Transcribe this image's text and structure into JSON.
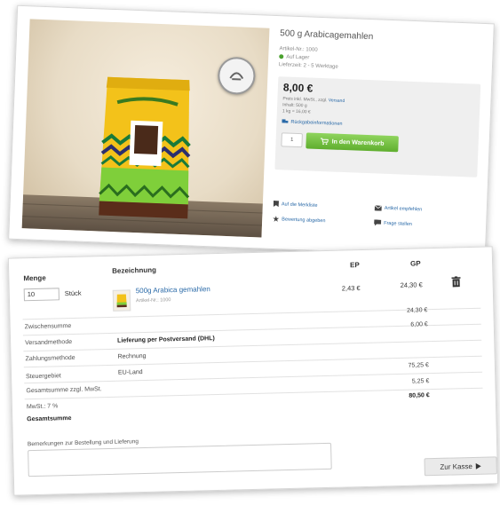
{
  "product": {
    "title": "500 g Arabicagemahlen",
    "article_no": "Artikel-Nr.: 1000",
    "availability": "Auf Lager",
    "delivery": "Lieferzeit: 2 - 5 Werktage",
    "price": "8,00 €",
    "price_note": "Preis inkl. MwSt., zzgl.",
    "shipping_link": "Versand",
    "unit_price": "Inhalt: 500 g",
    "base_price": "1 kg = 16,00 €",
    "basket_link": "Rückgabeinformationen",
    "qty_value": "1",
    "cart_button": "In den Warenkorb",
    "actions": [
      {
        "label": "Auf die Merkliste",
        "icon": "bookmark-icon"
      },
      {
        "label": "Artikel empfehlen",
        "icon": "mail-icon"
      },
      {
        "label": "Bewertung abgeben",
        "icon": "star-icon"
      },
      {
        "label": "Frage stellen",
        "icon": "chat-icon"
      }
    ]
  },
  "cart": {
    "headers": {
      "qty": "Menge",
      "desc": "Bezeichnung",
      "unit": "EP",
      "total": "GP"
    },
    "item": {
      "qty": "10",
      "unit_label": "Stück",
      "name": "500g Arabica gemahlen",
      "article_no": "Artikel-Nr.: 1000",
      "unit_price": "2,43 €",
      "total_price": "24,30 €"
    },
    "summary": [
      {
        "label": "Zwischensumme",
        "value": "",
        "amount": "24,30 €",
        "bold": false
      },
      {
        "label": "Versandmethode",
        "value": "Lieferung per Postversand (DHL)",
        "amount": "6,00 €",
        "bold": true
      },
      {
        "label": "Zahlungsmethode",
        "value": "Rechnung",
        "amount": "",
        "bold": false
      },
      {
        "label": "Steuergebiet",
        "value": "EU-Land",
        "amount": "",
        "bold": false
      },
      {
        "label": "Gesamtsumme zzgl. MwSt.",
        "value": "",
        "amount": "75,25 €",
        "bold": false
      },
      {
        "label": "MwSt.: 7 %",
        "value": "",
        "amount": "5,25 €",
        "bold": false
      },
      {
        "label": "Gesamtsumme",
        "value": "",
        "amount": "80,50 €",
        "bold": true
      }
    ],
    "comment_label": "Bemerkungen zur Bestellung und Lieferung",
    "checkout_button": "Zur Kasse"
  }
}
